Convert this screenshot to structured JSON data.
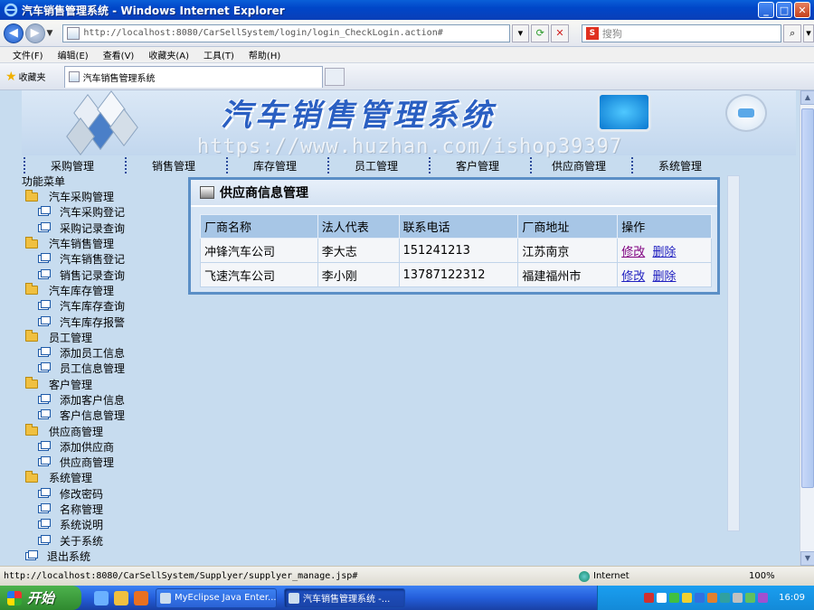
{
  "window": {
    "title": "汽车销售管理系统 - Windows Internet Explorer",
    "min": "_",
    "max": "□",
    "close": "✕"
  },
  "browser": {
    "address": "http://localhost:8080/CarSellSystem/login/login_CheckLogin.action#",
    "address_host": "localhost",
    "search_placeholder": "搜狗",
    "search_engine": "S",
    "menu": [
      "文件(F)",
      "编辑(E)",
      "查看(V)",
      "收藏夹(A)",
      "工具(T)",
      "帮助(H)"
    ],
    "favorites_label": "收藏夹",
    "tab_title": "汽车销售管理系统"
  },
  "banner": {
    "title": "汽车销售管理系统",
    "watermark": "https://www.huzhan.com/ishop39397"
  },
  "topnav": [
    "采购管理",
    "销售管理",
    "库存管理",
    "员工管理",
    "客户管理",
    "供应商管理",
    "系统管理"
  ],
  "tree": {
    "title": "功能菜单",
    "groups": [
      {
        "label": "汽车采购管理",
        "items": [
          "汽车采购登记",
          "采购记录查询"
        ]
      },
      {
        "label": "汽车销售管理",
        "items": [
          "汽车销售登记",
          "销售记录查询"
        ]
      },
      {
        "label": "汽车库存管理",
        "items": [
          "汽车库存查询",
          "汽车库存报警"
        ]
      },
      {
        "label": "员工管理",
        "items": [
          "添加员工信息",
          "员工信息管理"
        ]
      },
      {
        "label": "客户管理",
        "items": [
          "添加客户信息",
          "客户信息管理"
        ]
      },
      {
        "label": "供应商管理",
        "items": [
          "添加供应商",
          "供应商管理"
        ]
      },
      {
        "label": "系统管理",
        "items": [
          "修改密码",
          "名称管理",
          "系统说明",
          "关于系统"
        ]
      }
    ],
    "logout": "退出系统"
  },
  "panel": {
    "title": "供应商信息管理",
    "columns": [
      "厂商名称",
      "法人代表",
      "联系电话",
      "厂商地址",
      "操作"
    ],
    "rows": [
      {
        "name": "冲锋汽车公司",
        "rep": "李大志",
        "phone": "151241213",
        "addr": "江苏南京",
        "edit": "修改",
        "delete": "删除"
      },
      {
        "name": "飞速汽车公司",
        "rep": "李小刚",
        "phone": "13787122312",
        "addr": "福建福州市",
        "edit": "修改",
        "delete": "删除"
      }
    ]
  },
  "status": {
    "url": "http://localhost:8080/CarSellSystem/Supplyer/supplyer_manage.jsp#",
    "zone": "Internet",
    "zoom": "100%"
  },
  "taskbar": {
    "start": "开始",
    "tasks": [
      "MyEclipse Java Enter...",
      "汽车销售管理系统 -..."
    ],
    "clock": "16:09"
  },
  "colors": {
    "accent": "#2a5fc2",
    "panel_border": "#5b8fc6",
    "table_header": "#a7c6e6",
    "content_bg": "#c7dcef"
  }
}
